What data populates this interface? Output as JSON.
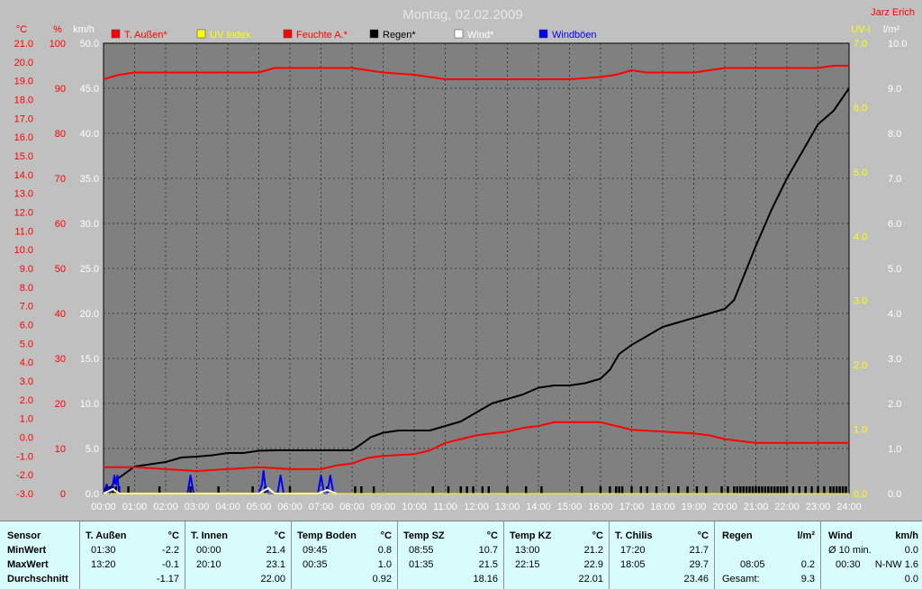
{
  "chart_data": {
    "type": "line",
    "title": "Montag, 02.02.2009",
    "watermark": "Jarz Erich",
    "x_ticks": [
      "00:00",
      "01:00",
      "02:00",
      "03:00",
      "04:00",
      "05:00",
      "06:00",
      "07:00",
      "08:00",
      "09:00",
      "10:00",
      "11:00",
      "12:00",
      "13:00",
      "14:00",
      "15:00",
      "16:00",
      "17:00",
      "18:00",
      "19:00",
      "20:00",
      "21:00",
      "22:00",
      "23:00",
      "24:00"
    ],
    "axes": {
      "temp": {
        "unit": "°C",
        "ticks": [
          "21.0",
          "20.0",
          "19.0",
          "18.0",
          "17.0",
          "16.0",
          "15.0",
          "14.0",
          "13.0",
          "12.0",
          "11.0",
          "10.0",
          "9.0",
          "8.0",
          "7.0",
          "6.0",
          "5.0",
          "4.0",
          "3.0",
          "2.0",
          "1.0",
          "0.0",
          "-1.0",
          "-2.0",
          "-3.0"
        ],
        "range": [
          -3,
          21
        ],
        "color": "#ff0000"
      },
      "humidity": {
        "unit": "%",
        "ticks": [
          "100",
          "90",
          "80",
          "70",
          "60",
          "50",
          "40",
          "30",
          "20",
          "10",
          "0"
        ],
        "range": [
          0,
          100
        ],
        "color": "#ff0000"
      },
      "wind": {
        "unit": "km/h",
        "ticks": [
          "50.0",
          "45.0",
          "40.0",
          "35.0",
          "30.0",
          "25.0",
          "20.0",
          "15.0",
          "10.0",
          "5.0",
          "0.0"
        ],
        "range": [
          0,
          50
        ],
        "color": "#ffffff"
      },
      "uv": {
        "unit": "UV-I",
        "ticks": [
          "7.0",
          "6.0",
          "5.0",
          "4.0",
          "3.0",
          "2.0",
          "1.0",
          "0.0"
        ],
        "range": [
          0,
          7
        ],
        "color": "#ffff00"
      },
      "rain": {
        "unit": "l/m²",
        "ticks": [
          "10.0",
          "9.0",
          "8.0",
          "7.0",
          "6.0",
          "5.0",
          "4.0",
          "3.0",
          "2.0",
          "1.0",
          "0.0"
        ],
        "range": [
          0,
          10
        ],
        "color": "#ffffff"
      }
    },
    "legend": [
      {
        "name": "T. Außen*",
        "color": "#ff0000"
      },
      {
        "name": "UV Index",
        "color": "#ffff00"
      },
      {
        "name": "Feuchte A.*",
        "color": "#ff0000"
      },
      {
        "name": "Regen*",
        "color": "#000000"
      },
      {
        "name": "Wind*",
        "color": "#ffffff"
      },
      {
        "name": "Windböen",
        "color": "#0000ff"
      }
    ],
    "series": [
      {
        "name": "Regen*",
        "axis": "rain",
        "color": "#000000",
        "x": [
          0,
          0.2,
          0.4,
          0.6,
          1,
          1.5,
          2,
          2.5,
          3,
          3.5,
          4,
          4.5,
          5,
          5.5,
          6,
          6.5,
          7,
          7.5,
          8,
          8.3,
          8.6,
          9,
          9.5,
          10,
          10.5,
          11,
          11.5,
          12,
          12.5,
          13,
          13.5,
          14,
          14.5,
          15,
          15.5,
          16,
          16.3,
          16.6,
          17,
          17.5,
          18,
          18.5,
          19,
          19.5,
          20,
          20.3,
          21,
          21.5,
          22,
          22.5,
          23,
          23.5,
          24
        ],
        "values": [
          0,
          0.1,
          0.3,
          0.4,
          0.6,
          0.65,
          0.7,
          0.8,
          0.82,
          0.85,
          0.9,
          0.9,
          0.95,
          0.96,
          0.96,
          0.96,
          0.96,
          0.96,
          0.96,
          1.1,
          1.25,
          1.35,
          1.4,
          1.4,
          1.4,
          1.5,
          1.6,
          1.8,
          2.0,
          2.1,
          2.2,
          2.35,
          2.4,
          2.4,
          2.45,
          2.55,
          2.75,
          3.1,
          3.3,
          3.5,
          3.7,
          3.8,
          3.9,
          4.0,
          4.1,
          4.3,
          5.5,
          6.3,
          7.0,
          7.6,
          8.2,
          8.5,
          9.0
        ]
      },
      {
        "name": "Feuchte A.*",
        "axis": "humidity",
        "color": "#ff0000",
        "x": [
          0,
          0.5,
          1,
          2,
          3,
          4,
          5,
          5.5,
          6,
          7,
          8,
          8.5,
          9,
          10,
          11,
          12,
          13,
          14,
          15,
          16,
          16.5,
          17,
          17.5,
          18,
          19,
          20,
          21,
          22,
          23,
          23.5,
          24
        ],
        "values": [
          92,
          93,
          93.5,
          93.5,
          93.5,
          93.5,
          93.5,
          94.5,
          94.5,
          94.5,
          94.5,
          94,
          93.5,
          93,
          92,
          92,
          92,
          92,
          92,
          92.5,
          93,
          94,
          93.5,
          93.5,
          93.5,
          94.5,
          94.5,
          94.5,
          94.5,
          95,
          95
        ]
      },
      {
        "name": "T. Außen*",
        "axis": "temp",
        "color": "#ff0000",
        "x": [
          0,
          1,
          2,
          3,
          4,
          5,
          6,
          7,
          7.5,
          8,
          8.5,
          9,
          10,
          10.5,
          11,
          11.5,
          12,
          12.5,
          13,
          13.5,
          14,
          14.5,
          15,
          15.5,
          16,
          16.5,
          17,
          18,
          19,
          19.5,
          20,
          20.5,
          21,
          22,
          23,
          24
        ],
        "values": [
          -1.6,
          -1.6,
          -1.7,
          -1.8,
          -1.7,
          -1.6,
          -1.7,
          -1.7,
          -1.5,
          -1.4,
          -1.1,
          -1.0,
          -0.9,
          -0.7,
          -0.3,
          -0.1,
          0.1,
          0.2,
          0.3,
          0.5,
          0.6,
          0.8,
          0.8,
          0.8,
          0.8,
          0.6,
          0.4,
          0.3,
          0.2,
          0.1,
          -0.1,
          -0.2,
          -0.3,
          -0.3,
          -0.3,
          -0.3
        ]
      },
      {
        "name": "Windböen",
        "axis": "wind",
        "color": "#0000ff",
        "x": [
          0,
          0.1,
          0.2,
          0.3,
          0.35,
          0.4,
          0.45,
          0.5,
          2.7,
          2.8,
          2.9,
          5.0,
          5.1,
          5.15,
          5.2,
          5.3,
          5.6,
          5.7,
          5.8,
          6.9,
          7.0,
          7.1,
          7.2,
          7.3,
          7.4
        ],
        "values": [
          0,
          1,
          0,
          1,
          2,
          1,
          2,
          0,
          0,
          2,
          0,
          0,
          1,
          2.5,
          1,
          0,
          0,
          2,
          0,
          0,
          2,
          0,
          0,
          2,
          0
        ]
      },
      {
        "name": "Wind*",
        "axis": "wind",
        "color": "#ffffff",
        "x": [
          0,
          0.3,
          0.5,
          5.0,
          5.3,
          5.5,
          6.9,
          7.2,
          7.5
        ],
        "values": [
          0,
          0.5,
          0,
          0,
          0.6,
          0,
          0,
          0.4,
          0
        ]
      },
      {
        "name": "UV Index",
        "axis": "uv",
        "color": "#ffff00",
        "x": [
          0,
          24
        ],
        "values": [
          0,
          0
        ]
      }
    ],
    "rain_events": [
      0.1,
      0.2,
      0.3,
      0.4,
      0.5,
      0.8,
      1.8,
      2.8,
      3.7,
      4.8,
      5.2,
      6.0,
      7.2,
      8.1,
      8.3,
      8.7,
      10.6,
      11.1,
      11.5,
      11.7,
      11.9,
      12.2,
      12.4,
      13.0,
      13.6,
      14.1,
      15.4,
      16.0,
      16.3,
      16.5,
      16.6,
      16.7,
      17.0,
      17.3,
      17.5,
      17.8,
      18.2,
      18.5,
      18.8,
      19.1,
      19.4,
      19.9,
      20.1,
      20.3,
      20.4,
      20.5,
      20.6,
      20.7,
      20.8,
      20.9,
      21.0,
      21.1,
      21.2,
      21.3,
      21.4,
      21.5,
      21.6,
      21.7,
      21.8,
      21.9,
      22.0,
      22.2,
      22.4,
      22.6,
      22.8,
      23.0,
      23.2,
      23.4,
      23.5,
      23.6,
      23.7,
      23.8,
      23.9
    ]
  },
  "stats": {
    "row_labels": [
      "Sensor",
      "MinWert",
      "MaxWert",
      "Durchschnitt"
    ],
    "columns": [
      {
        "name": "T. Außen",
        "unit": "°C",
        "min_time": "01:30",
        "min": "-2.2",
        "max_time": "13:20",
        "max": "-0.1",
        "avg": "-1.17"
      },
      {
        "name": "T. Innen",
        "unit": "°C",
        "min_time": "00:00",
        "min": "21.4",
        "max_time": "20:10",
        "max": "23.1",
        "avg": "22.00"
      },
      {
        "name": "Temp Boden",
        "unit": "°C",
        "min_time": "09:45",
        "min": "0.8",
        "max_time": "00:35",
        "max": "1.0",
        "avg": "0.92"
      },
      {
        "name": "Temp SZ",
        "unit": "°C",
        "min_time": "08:55",
        "min": "10.7",
        "max_time": "01:35",
        "max": "21.5",
        "avg": "18.16"
      },
      {
        "name": "Temp KZ",
        "unit": "°C",
        "min_time": "13:00",
        "min": "21.2",
        "max_time": "22:15",
        "max": "22.9",
        "avg": "22.01"
      },
      {
        "name": "T. Chilis",
        "unit": "°C",
        "min_time": "17:20",
        "min": "21.7",
        "max_time": "18:05",
        "max": "29.7",
        "avg": "23.46"
      }
    ],
    "regen": {
      "name": "Regen",
      "unit": "l/m²",
      "time": "08:05",
      "value": "0.2",
      "total_label": "Gesamt:",
      "total": "9.3"
    },
    "wind": {
      "name": "Wind",
      "unit": "km/h",
      "avg_label": "Ø 10 min.",
      "avg_value": "0.0",
      "time": "00:30",
      "dir_value": "N-NW 1.6",
      "last": "0.0"
    }
  }
}
